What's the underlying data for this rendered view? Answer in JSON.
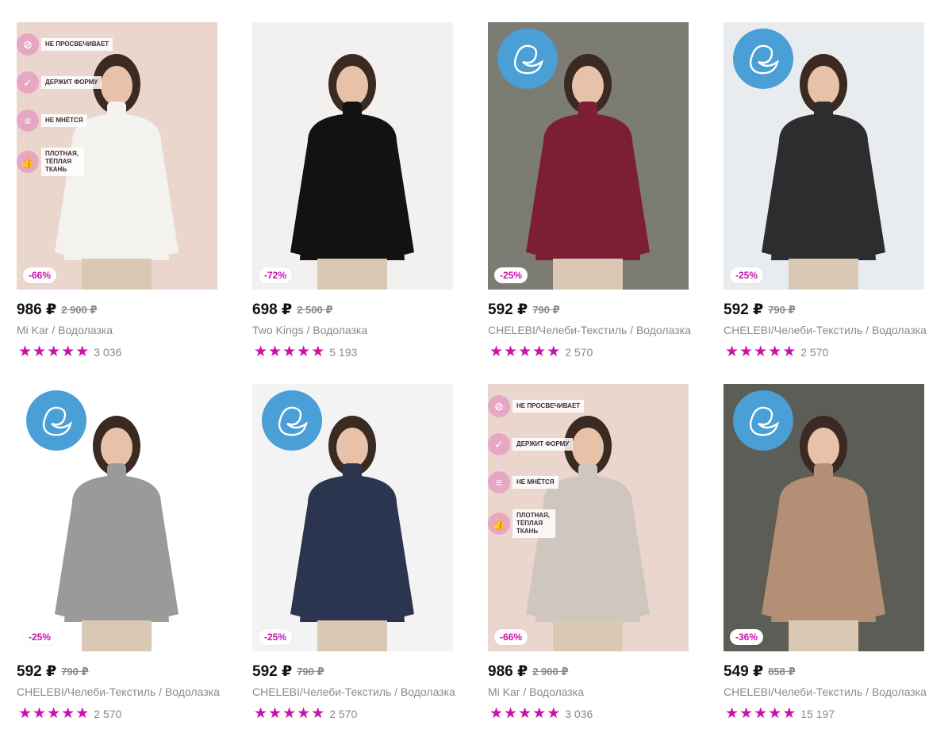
{
  "products": [
    {
      "price": "986 ₽",
      "old_price": "2 900 ₽",
      "name": "Mi Kar / Водолазка",
      "discount": "-66%",
      "rating_count": "3 036",
      "stars": 5,
      "sweater_color": "#f4f2ef",
      "bg": "#ead6cc",
      "badge": "features"
    },
    {
      "price": "698 ₽",
      "old_price": "2 500 ₽",
      "name": "Two Kings / Водолазка",
      "discount": "-72%",
      "rating_count": "5 193",
      "stars": 5,
      "sweater_color": "#121212",
      "bg": "#f2f1ef",
      "badge": "none"
    },
    {
      "price": "592 ₽",
      "old_price": "790 ₽",
      "name": "CHELEBI/Челеби-Текстиль / Водолазка",
      "discount": "-25%",
      "rating_count": "2 570",
      "stars": 5,
      "sweater_color": "#7c1f36",
      "bg": "#7c7b74",
      "badge": "logo"
    },
    {
      "price": "592 ₽",
      "old_price": "790 ₽",
      "name": "CHELEBI/Челеби-Текстиль / Водолазка",
      "discount": "-25%",
      "rating_count": "2 570",
      "stars": 5,
      "sweater_color": "#2d2d2f",
      "bg": "#e9ecef",
      "badge": "logo"
    },
    {
      "price": "592 ₽",
      "old_price": "790 ₽",
      "name": "CHELEBI/Челеби-Текстиль / Водолазка",
      "discount": "-25%",
      "rating_count": "2 570",
      "stars": 5,
      "sweater_color": "#9a9a9a",
      "bg": "#ffffff",
      "badge": "logo"
    },
    {
      "price": "592 ₽",
      "old_price": "790 ₽",
      "name": "CHELEBI/Челеби-Текстиль / Водолазка",
      "discount": "-25%",
      "rating_count": "2 570",
      "stars": 5,
      "sweater_color": "#2b3550",
      "bg": "#f3f3f3",
      "badge": "logo"
    },
    {
      "price": "986 ₽",
      "old_price": "2 900 ₽",
      "name": "Mi Kar / Водолазка",
      "discount": "-66%",
      "rating_count": "3 036",
      "stars": 5,
      "sweater_color": "#cfc6bf",
      "bg": "#ead6cc",
      "badge": "features"
    },
    {
      "price": "549 ₽",
      "old_price": "858 ₽",
      "name": "CHELEBI/Челеби-Текстиль / Водолазка",
      "discount": "-36%",
      "rating_count": "15 197",
      "stars": 5,
      "sweater_color": "#b48f76",
      "bg": "#5c5d56",
      "badge": "logo"
    }
  ],
  "features": [
    {
      "icon": "eye-off-icon",
      "label": "НЕ ПРОСВЕЧИВАЕТ"
    },
    {
      "icon": "check-icon",
      "label": "ДЕРЖИТ ФОРМУ"
    },
    {
      "icon": "fabric-icon",
      "label": "НЕ МНЁТСЯ"
    },
    {
      "icon": "thumbs-up-icon",
      "label": "ПЛОТНАЯ, ТЁПЛАЯ ТКАНЬ"
    }
  ],
  "colors": {
    "accent": "#cb11ab",
    "muted": "#8a8a8a",
    "logo_blue": "#4a9fd6",
    "feature_pink": "#e7a6c4"
  }
}
